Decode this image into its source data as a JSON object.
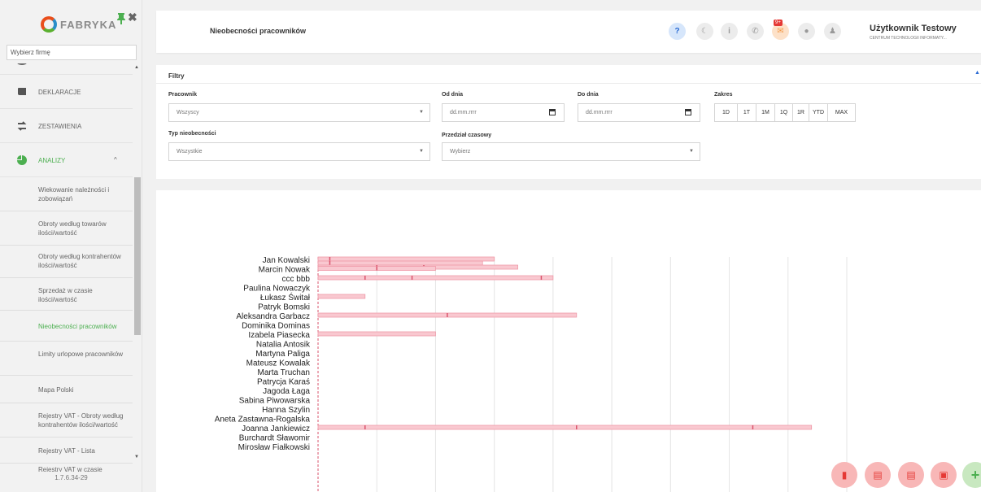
{
  "app": {
    "logo_text": "FABRYKA",
    "version": "1.7.6.34-29"
  },
  "sidebar": {
    "firm_placeholder": "Wybierz firmę",
    "items": [
      {
        "label": "DEKLARACJE",
        "icon": "book-icon"
      },
      {
        "label": "ZESTAWIENIA",
        "icon": "exchange-icon"
      },
      {
        "label": "ANALIZY",
        "icon": "pie-chart-icon",
        "active": true
      }
    ],
    "sub_items": [
      {
        "label": "Wiekowanie należności i zobowiązań"
      },
      {
        "label": "Obroty według towarów ilości/wartość"
      },
      {
        "label": "Obroty według kontrahentów ilości/wartość"
      },
      {
        "label": "Sprzedaż w czasie ilości/wartość"
      },
      {
        "label": "Nieobecności pracowników",
        "active": true
      },
      {
        "label": "Limity urlopowe pracowników"
      },
      {
        "label": "Mapa Polski"
      },
      {
        "label": "Rejestry VAT - Obroty według kontrahentów ilości/wartość"
      },
      {
        "label": "Rejestry VAT - Lista"
      },
      {
        "label": "Rejestry VAT w czasie"
      }
    ]
  },
  "header": {
    "title": "Nieobecności pracowników",
    "help_label": "?",
    "mail_badge": "9+",
    "user_name": "Użytkownik Testowy",
    "user_company": "CENTRUM TECHNOLOGII INFORMATY..."
  },
  "filters": {
    "title": "Filtry",
    "employee_label": "Pracownik",
    "employee_value": "Wszyscy",
    "from_label": "Od dnia",
    "from_placeholder": "dd.mm.rrrr",
    "to_label": "Do dnia",
    "to_placeholder": "dd.mm.rrrr",
    "range_label": "Zakres",
    "range_options": [
      "1D",
      "1T",
      "1M",
      "1Q",
      "1R",
      "YTD",
      "MAX"
    ],
    "absence_type_label": "Typ nieobecności",
    "absence_type_value": "Wszystkie",
    "period_label": "Przedział czasowy",
    "period_value": "Wybierz"
  },
  "colors": {
    "accent_green": "#4caf50",
    "bar_fill": "#f9c8d0",
    "bar_stroke": "#ef9aa8",
    "marker": "#d9536b"
  },
  "chart_data": {
    "type": "bar",
    "rows": [
      "Jan Kowalski",
      "Marcin Nowak",
      "ccc bbb",
      "Paulina Nowaczyk",
      "Łukasz Świtał",
      "Patryk Bomski",
      "Aleksandra Garbacz",
      "Dominika Dominas",
      "Izabela Piasecka",
      "Natalia Antosik",
      "Martyna Paliga",
      "Mateusz Kowalak",
      "Marta Truchan",
      "Patrycja Karaś",
      "Jagoda Łaga",
      "Sabina Piwowarska",
      "Hanna Szylin",
      "Aneta Zastawna-Rogalska",
      "Joanna Jankiewicz",
      "Burchardt Sławomir",
      "Mirosław Fiałkowski"
    ],
    "bars": [
      {
        "row": 0,
        "sub": 0,
        "start": 0,
        "end": 30,
        "marks": [
          2
        ]
      },
      {
        "row": 0,
        "sub": 1,
        "start": 0,
        "end": 28,
        "marks": [
          2
        ]
      },
      {
        "row": 0,
        "sub": 2,
        "start": 0,
        "end": 34,
        "marks": [
          10,
          18
        ]
      },
      {
        "row": 1,
        "sub": 0,
        "start": 0,
        "end": 20,
        "marks": [
          10
        ]
      },
      {
        "row": 2,
        "sub": 0,
        "start": 0,
        "end": 40,
        "marks": [
          8,
          16,
          38
        ]
      },
      {
        "row": 4,
        "sub": 0,
        "start": 0,
        "end": 8,
        "marks": []
      },
      {
        "row": 6,
        "sub": 0,
        "start": 0,
        "end": 44,
        "marks": [
          22
        ]
      },
      {
        "row": 8,
        "sub": 0,
        "start": 0,
        "end": 20,
        "marks": []
      },
      {
        "row": 18,
        "sub": 0,
        "start": 0,
        "end": 84,
        "marks": [
          8,
          44,
          74
        ]
      }
    ],
    "x_max": 90,
    "grid_count": 9,
    "grid": true
  },
  "fabs": [
    {
      "name": "export-book-fab",
      "icon": "book-icon",
      "label": "▮"
    },
    {
      "name": "export-pdf-fab",
      "icon": "pdf-file-icon",
      "label": "▤"
    },
    {
      "name": "export-excel-fab",
      "icon": "excel-file-icon",
      "label": "▤"
    },
    {
      "name": "import-file-fab",
      "icon": "file-upload-icon",
      "label": "▣"
    },
    {
      "name": "add-fab",
      "icon": "plus-icon",
      "label": "+"
    }
  ]
}
